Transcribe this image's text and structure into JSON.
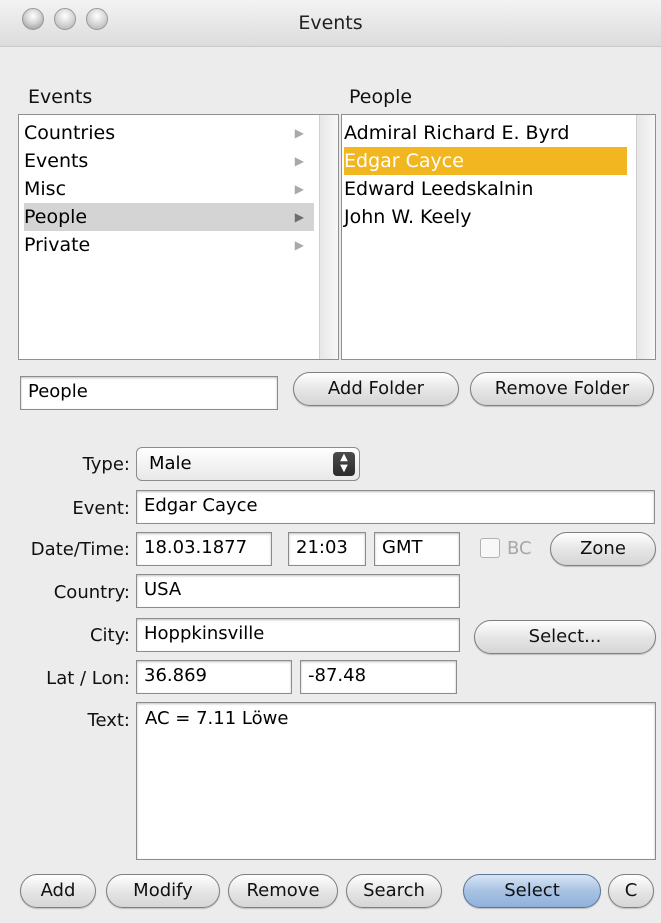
{
  "window": {
    "title": "Events"
  },
  "left_pane": {
    "header": "Events",
    "items": [
      {
        "label": "Countries"
      },
      {
        "label": "Events"
      },
      {
        "label": "Misc"
      },
      {
        "label": "People"
      },
      {
        "label": "Private"
      }
    ],
    "selected": "People"
  },
  "right_pane": {
    "header": "People",
    "items": [
      {
        "label": "Admiral Richard E. Byrd"
      },
      {
        "label": "Edgar Cayce"
      },
      {
        "label": "Edward Leedskalnin"
      },
      {
        "label": "John W. Keely"
      }
    ],
    "selected": "Edgar Cayce"
  },
  "folder": {
    "value": "People",
    "add_label": "Add Folder",
    "remove_label": "Remove Folder"
  },
  "form": {
    "type_label": "Type:",
    "type_value": "Male",
    "event_label": "Event:",
    "event_value": "Edgar Cayce",
    "datetime_label": "Date/Time:",
    "date_value": "18.03.1877",
    "time_value": "21:03",
    "zone_value": "GMT",
    "bc_label": "BC",
    "bc_checked": false,
    "zone_button": "Zone",
    "country_label": "Country:",
    "country_value": "USA",
    "city_label": "City:",
    "city_value": "Hoppkinsville",
    "select_city_button": "Select...",
    "latlon_label": "Lat / Lon:",
    "lat_value": "36.869",
    "lon_value": "-87.48",
    "text_label": "Text:",
    "text_value": "AC = 7.11 Löwe"
  },
  "bottom_bar": {
    "add": "Add",
    "modify": "Modify",
    "remove": "Remove",
    "search": "Search",
    "select": "Select",
    "c": "C"
  },
  "icons": {
    "arrow": "▶",
    "stepper_up": "▲",
    "stepper_down": "▼"
  },
  "colors": {
    "selection_gold": "#f2b620",
    "selection_grey": "#d4d4d4",
    "default_button_blue": "#a8c2e3"
  }
}
